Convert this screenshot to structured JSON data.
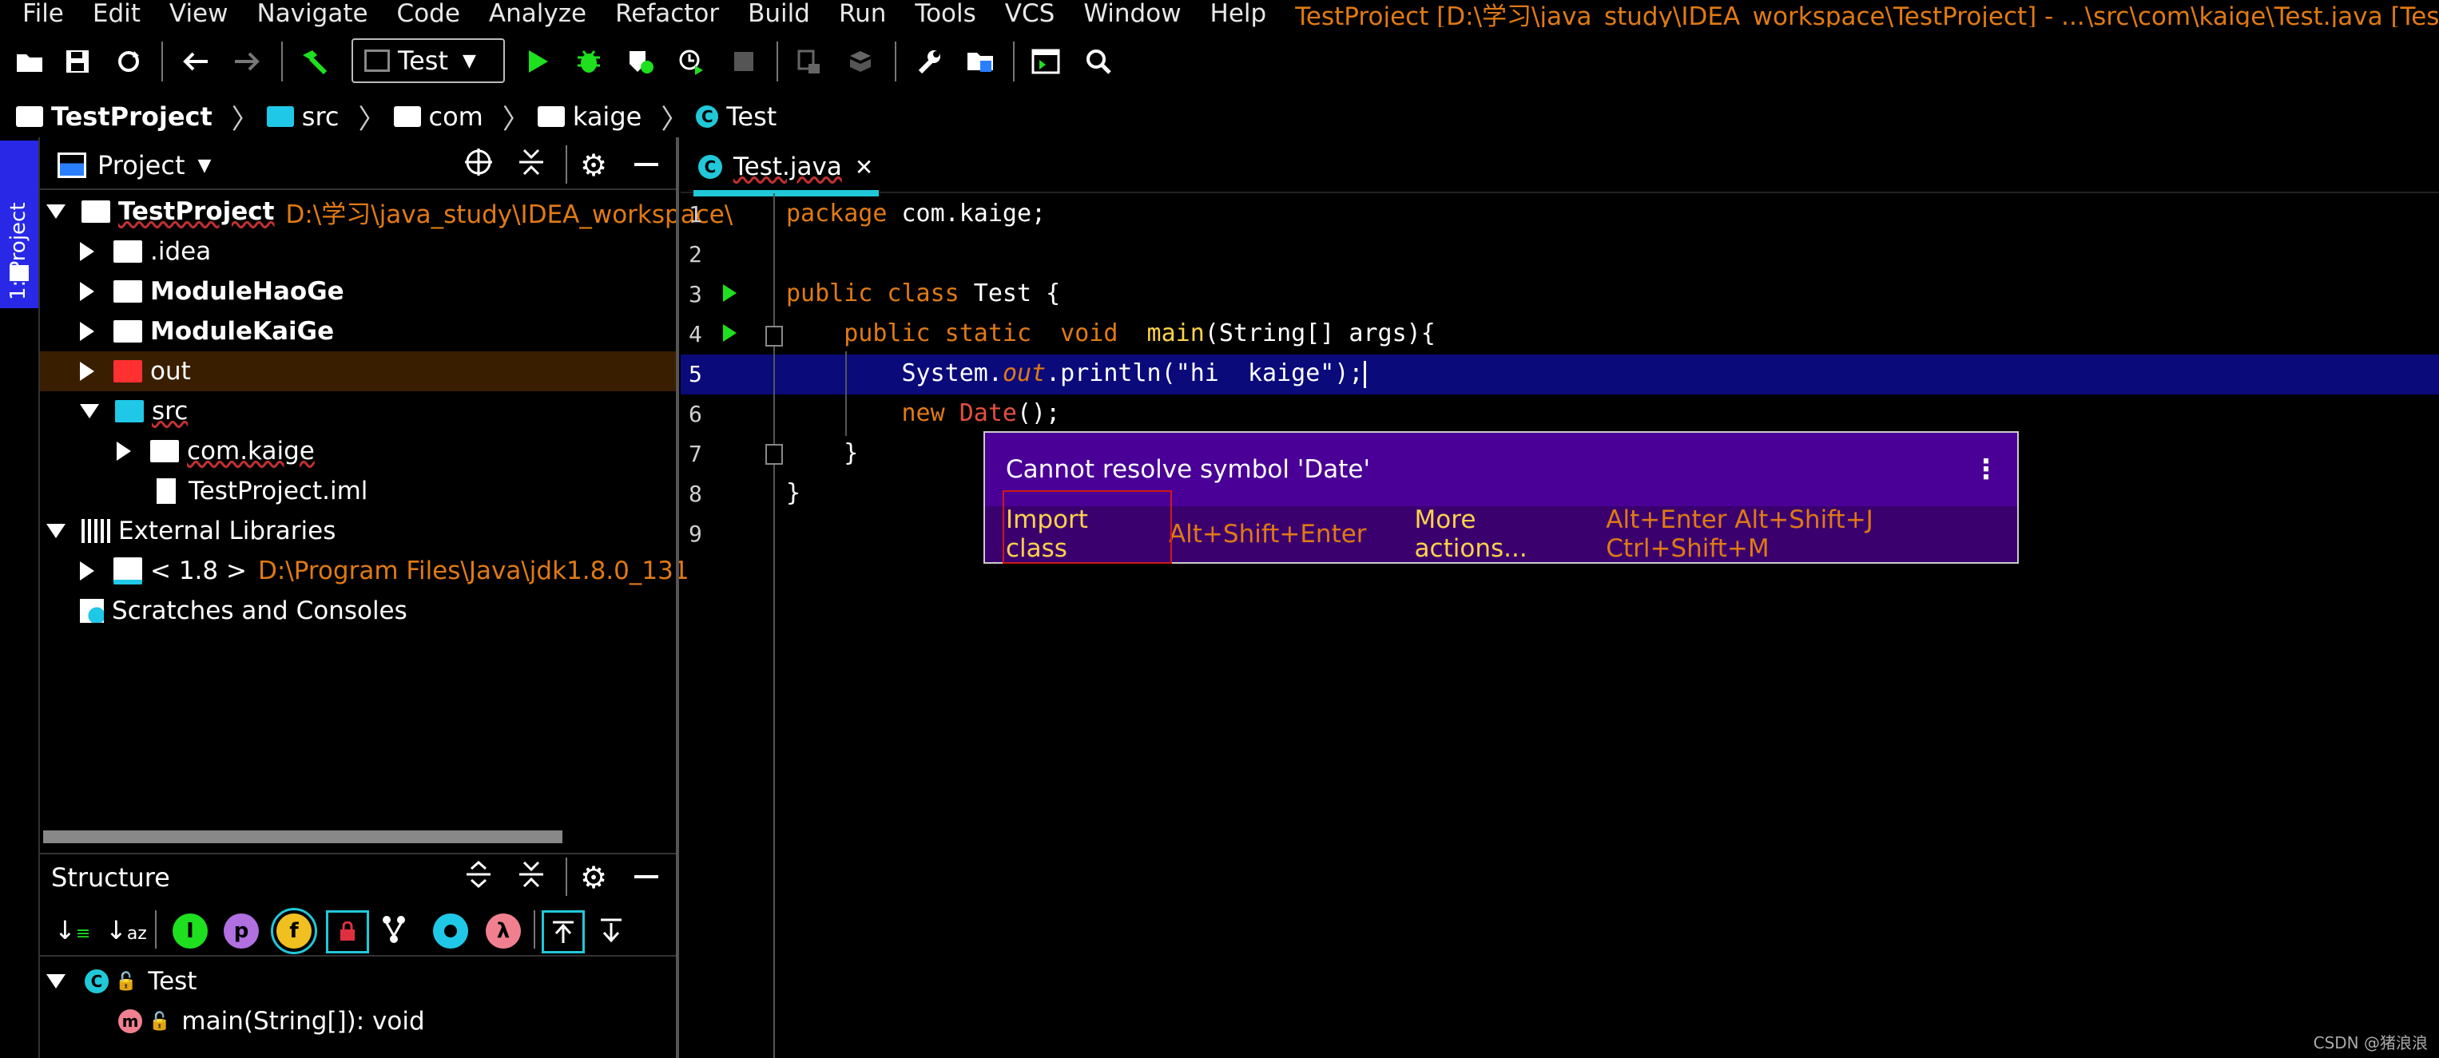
{
  "menubar": {
    "items": [
      "File",
      "Edit",
      "View",
      "Navigate",
      "Code",
      "Analyze",
      "Refactor",
      "Build",
      "Run",
      "Tools",
      "VCS",
      "Window",
      "Help"
    ],
    "window_title": "TestProject [D:\\学习\\java_study\\IDEA_workspace\\TestProject] - ...\\src\\com\\kaige\\Test.java [TestProject] -"
  },
  "toolbar": {
    "run_config": "Test"
  },
  "breadcrumb": [
    "TestProject",
    "src",
    "com",
    "kaige",
    "Test"
  ],
  "sidebar_stripe": {
    "label": "1: Project"
  },
  "project_panel": {
    "title": "Project",
    "tree": {
      "root_name": "TestProject",
      "root_path": "D:\\学习\\java_study\\IDEA_workspace\\",
      "idea": ".idea",
      "module1": "ModuleHaoGe",
      "module2": "ModuleKaiGe",
      "out": "out",
      "src": "src",
      "package": "com.kaige",
      "iml": "TestProject.iml",
      "ext_libs": "External Libraries",
      "jdk_name": "< 1.8 >",
      "jdk_path": "D:\\Program Files\\Java\\jdk1.8.0_131",
      "scratches": "Scratches and Consoles"
    }
  },
  "structure_panel": {
    "title": "Structure",
    "class_name": "Test",
    "method": "main(String[]): void",
    "filter_icons": [
      "I",
      "p",
      "f",
      "λ"
    ]
  },
  "editor": {
    "tab_label": "Test.java",
    "line_numbers": [
      "1",
      "2",
      "3",
      "4",
      "5",
      "6",
      "7",
      "8",
      "9"
    ],
    "lines": {
      "l1_kw": "package",
      "l1_rest": " com.kaige;",
      "l3_kw1": "public",
      "l3_kw2": " class",
      "l3_rest": " Test {",
      "l4_kw": "    public static  void",
      "l4_fn": "  main",
      "l4_rest": "(String[] args){",
      "l5_a": "        System.",
      "l5_out": "out",
      "l5_b": ".println(",
      "l5_str": "\"hi  kaige\"",
      "l5_c": ");",
      "l6_kw": "        new",
      "l6_err": " Date",
      "l6_rest": "();",
      "l7": "    }",
      "l8": "}"
    }
  },
  "popup": {
    "message": "Cannot resolve symbol 'Date'",
    "import_label": "Import class",
    "import_shortcut": "Alt+Shift+Enter",
    "more_label": "More actions...",
    "more_shortcut": "Alt+Enter Alt+Shift+J Ctrl+Shift+M"
  },
  "colors": {
    "accent_orange": "#e07a14",
    "keyword": "#e07a14",
    "popup_bg": "#4a0096",
    "current_line": "#0a0a7a",
    "tab_underline": "#20c8d8",
    "run_green": "#1ee01e"
  },
  "watermark": "CSDN @猪浪浪"
}
